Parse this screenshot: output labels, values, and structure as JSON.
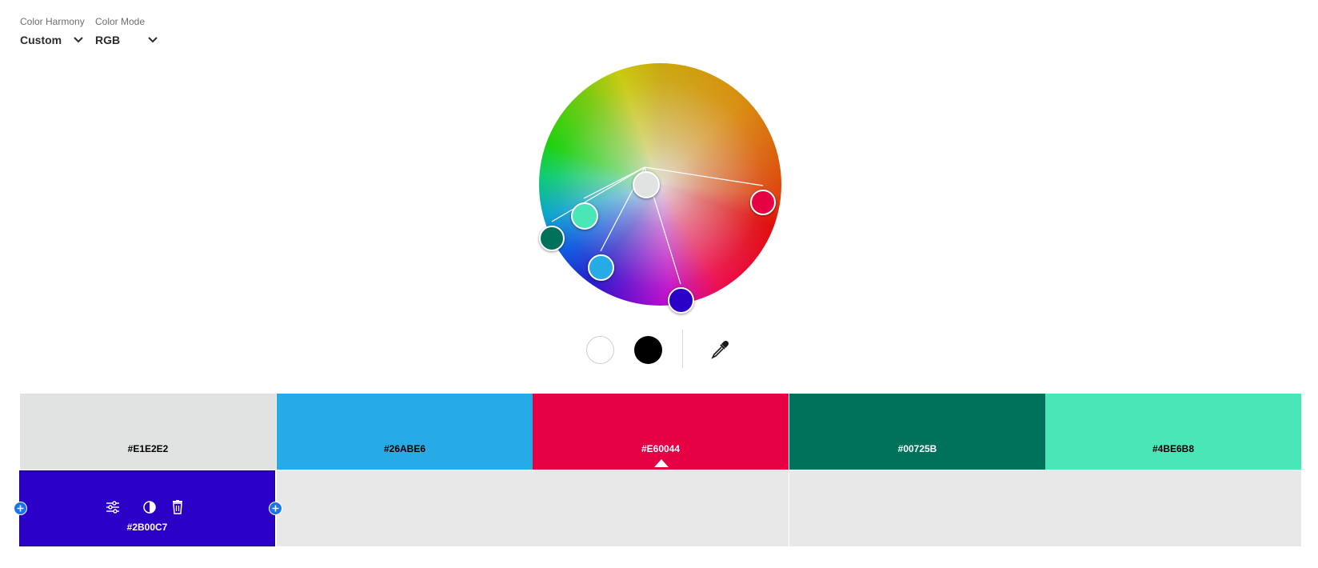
{
  "harmony": {
    "label": "Color Harmony",
    "value": "Custom"
  },
  "mode": {
    "label": "Color Mode",
    "value": "RGB"
  },
  "wheel": {
    "base_color": "#E1E2E2",
    "nodes": [
      {
        "name": "node-red",
        "color": "#E60044"
      },
      {
        "name": "node-dark-teal",
        "color": "#00725B"
      },
      {
        "name": "node-mint",
        "color": "#4BE6B8"
      },
      {
        "name": "node-sky-blue",
        "color": "#26ABE6"
      },
      {
        "name": "node-indigo",
        "color": "#2B00C7"
      }
    ]
  },
  "tools": {
    "white_icon": "white-swatch-icon",
    "black_icon": "black-swatch-icon",
    "eyedropper_icon": "eyedropper-icon"
  },
  "swatches": [
    {
      "hex": "#E1E2E2",
      "text_color": "#000000"
    },
    {
      "hex": "#26ABE6",
      "text_color": "#000000"
    },
    {
      "hex": "#E60044",
      "text_color": "#ffffff"
    },
    {
      "hex": "#00725B",
      "text_color": "#ffffff"
    },
    {
      "hex": "#4BE6B8",
      "text_color": "#000000"
    }
  ],
  "selected_swatch": {
    "hex": "#2B00C7",
    "icons": [
      "sliders-icon",
      "contrast-icon",
      "trash-icon"
    ]
  }
}
